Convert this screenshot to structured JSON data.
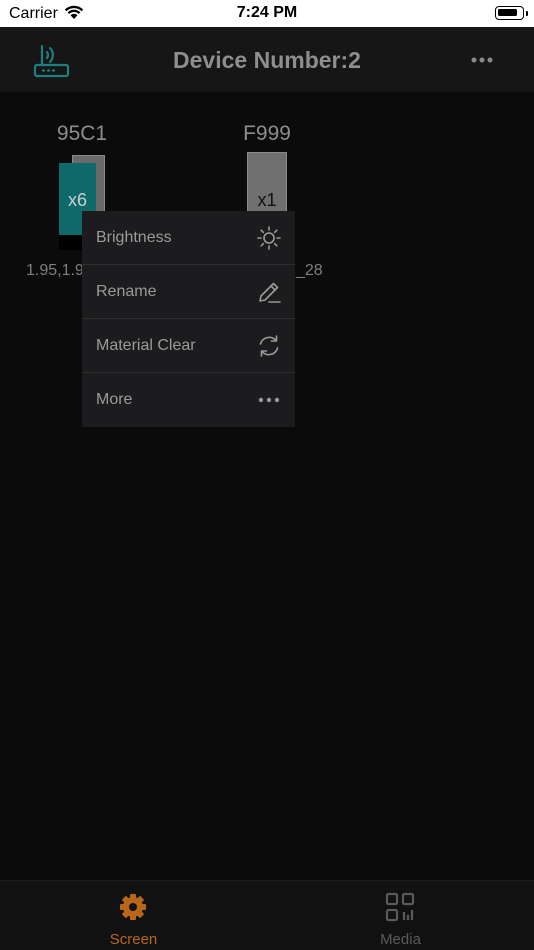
{
  "status_bar": {
    "carrier": "Carrier",
    "time": "7:24 PM"
  },
  "header": {
    "title": "Device Number:2",
    "left_icon": "router-icon",
    "right_icon": "more-icon"
  },
  "devices": [
    {
      "name": "95C1",
      "count": "x6",
      "info": "1.95,1.9",
      "card_color": "#0e6a6a"
    },
    {
      "name": "F999",
      "count": "x1",
      "info": "_28",
      "card_color": "#6f6f6f"
    }
  ],
  "menu": {
    "items": [
      {
        "label": "Brightness",
        "icon": "sun-icon"
      },
      {
        "label": "Rename",
        "icon": "pencil-icon"
      },
      {
        "label": "Material Clear",
        "icon": "refresh-icon"
      },
      {
        "label": "More",
        "icon": "more-icon"
      }
    ]
  },
  "tabbar": {
    "tabs": [
      {
        "label": "Screen",
        "icon": "gear-icon",
        "active": true,
        "color": "#b8661a"
      },
      {
        "label": "Media",
        "icon": "grid-icon",
        "active": false,
        "color": "#5a5a5a"
      }
    ]
  },
  "colors": {
    "accent": "#b8661a",
    "teal": "#0e6a6a"
  }
}
